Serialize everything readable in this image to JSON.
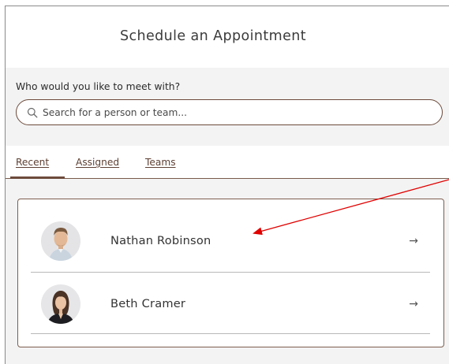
{
  "header": {
    "title": "Schedule an Appointment"
  },
  "search": {
    "question": "Who would you like to meet with?",
    "placeholder": "Search for a person or team..."
  },
  "tabs": [
    {
      "label": "Recent",
      "active": true
    },
    {
      "label": "Assigned",
      "active": false
    },
    {
      "label": "Teams",
      "active": false
    }
  ],
  "people": [
    {
      "name": "Nathan Robinson",
      "arrow": "→"
    },
    {
      "name": "Beth Cramer",
      "arrow": "→"
    }
  ],
  "colors": {
    "accent": "#6d4a3b",
    "annotation_arrow": "#e00000",
    "panel_background": "#f3f3f3"
  },
  "icons": {
    "search": "search-icon",
    "row_arrow": "arrow-right-icon"
  }
}
